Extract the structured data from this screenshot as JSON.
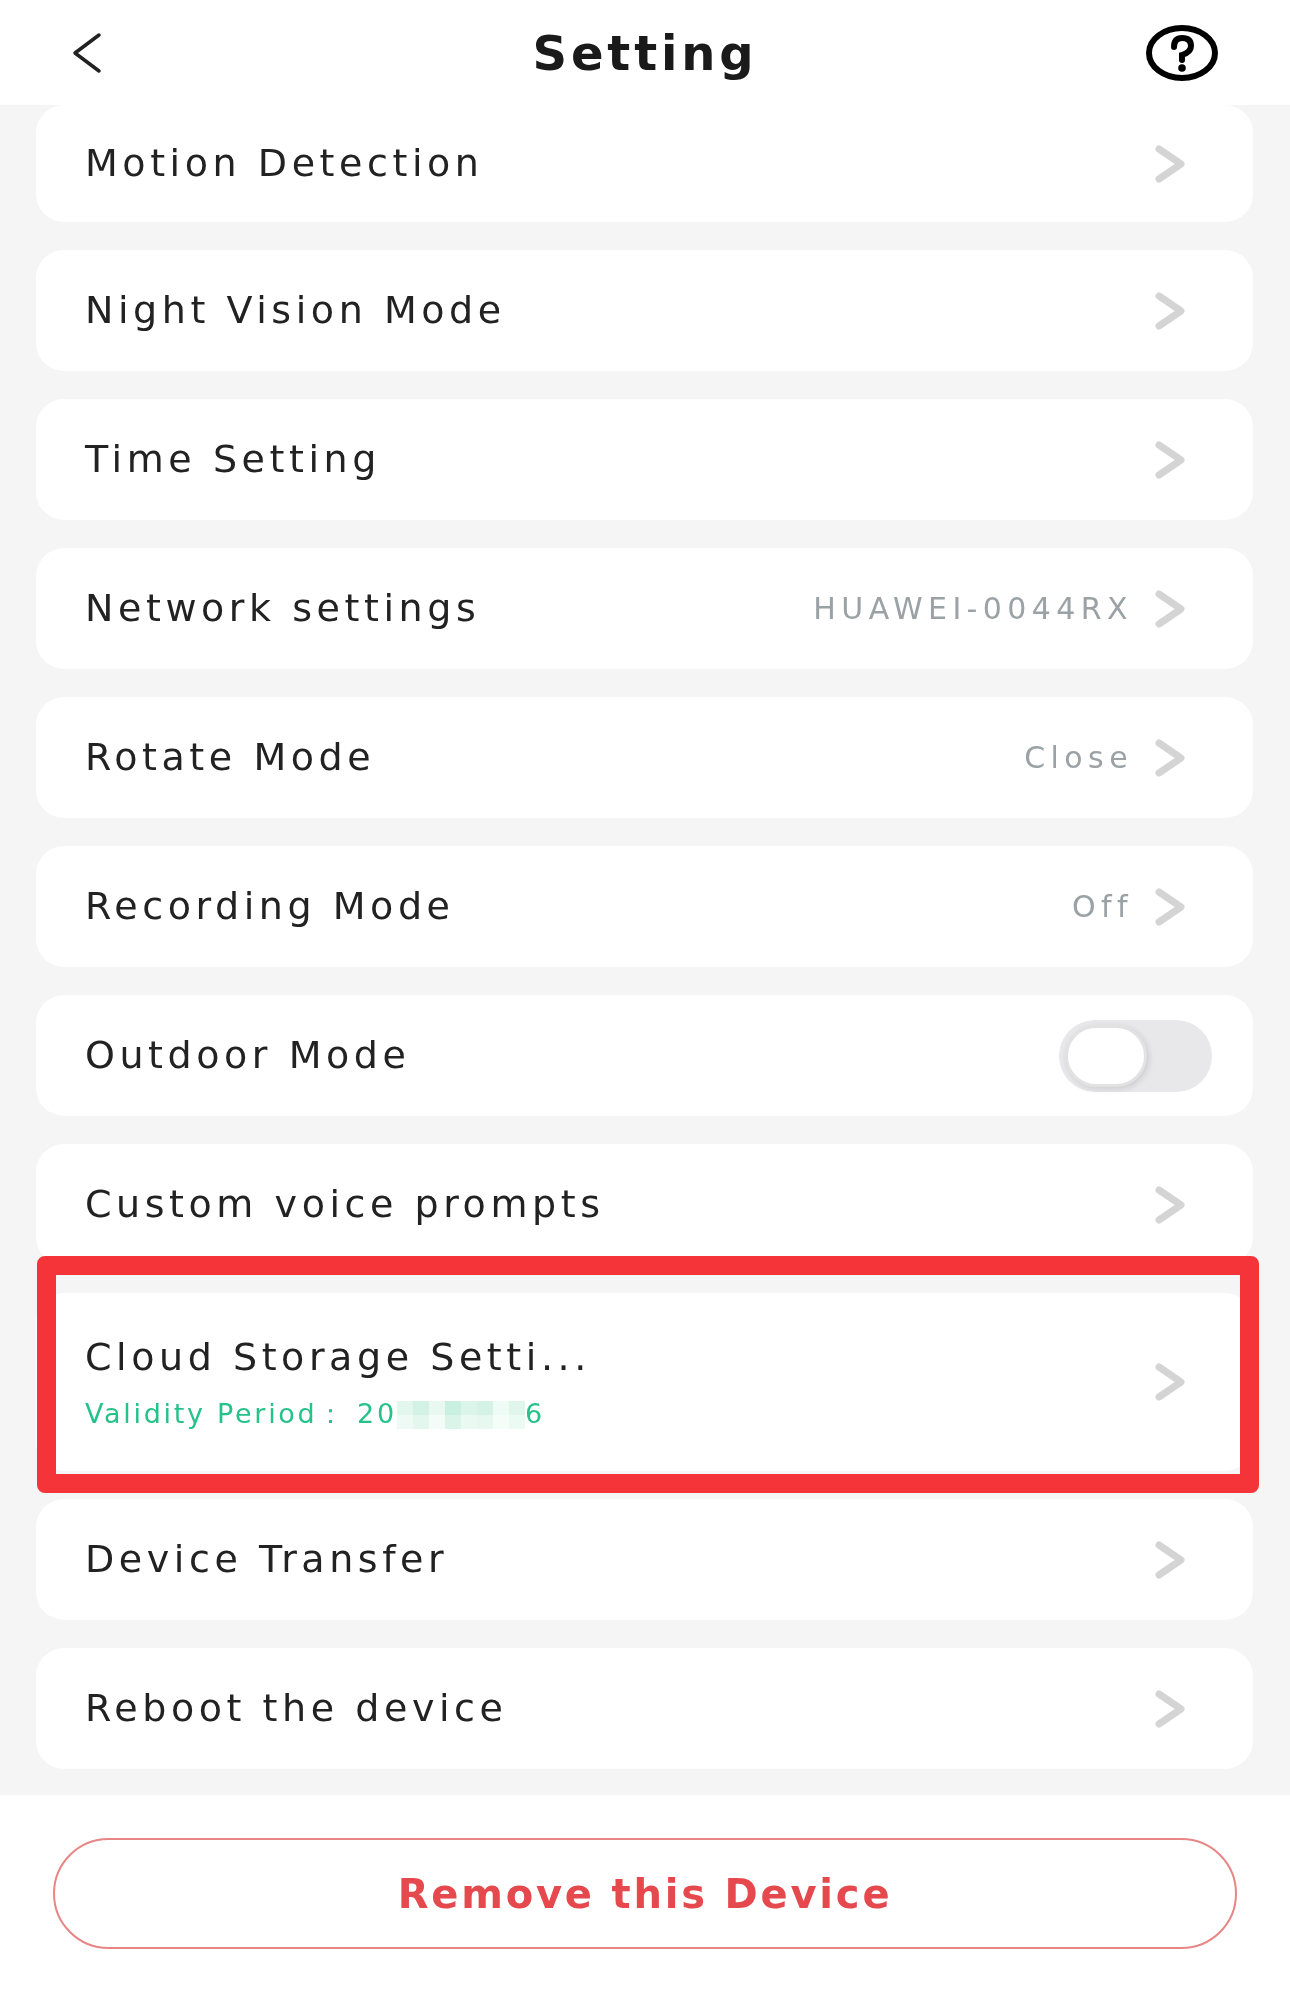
{
  "header": {
    "title": "Setting"
  },
  "items": [
    {
      "kind": "link",
      "label": "Motion Detection",
      "highlighted": false
    },
    {
      "kind": "link",
      "label": "Night Vision Mode",
      "highlighted": false
    },
    {
      "kind": "link",
      "label": "Time Setting",
      "highlighted": false
    },
    {
      "kind": "link",
      "label": "Network settings",
      "value": "HUAWEI-0044RX",
      "highlighted": false
    },
    {
      "kind": "link",
      "label": "Rotate Mode",
      "value": "Close",
      "highlighted": false
    },
    {
      "kind": "link",
      "label": "Recording Mode",
      "value": "Off",
      "highlighted": false
    },
    {
      "kind": "toggle",
      "label": "Outdoor Mode",
      "on": false,
      "highlighted": false
    },
    {
      "kind": "link",
      "label": "Custom voice prompts",
      "highlighted": false
    },
    {
      "kind": "subscription",
      "label": "Cloud Storage Setti...",
      "highlighted": true,
      "validity": {
        "label": "Validity Period：",
        "value_start": "20",
        "value_end": "6",
        "redacted": true
      }
    },
    {
      "kind": "link",
      "label": "Device Transfer",
      "highlighted": false
    },
    {
      "kind": "link",
      "label": "Reboot the device",
      "highlighted": false
    }
  ],
  "remove_button": {
    "label": "Remove this Device"
  }
}
